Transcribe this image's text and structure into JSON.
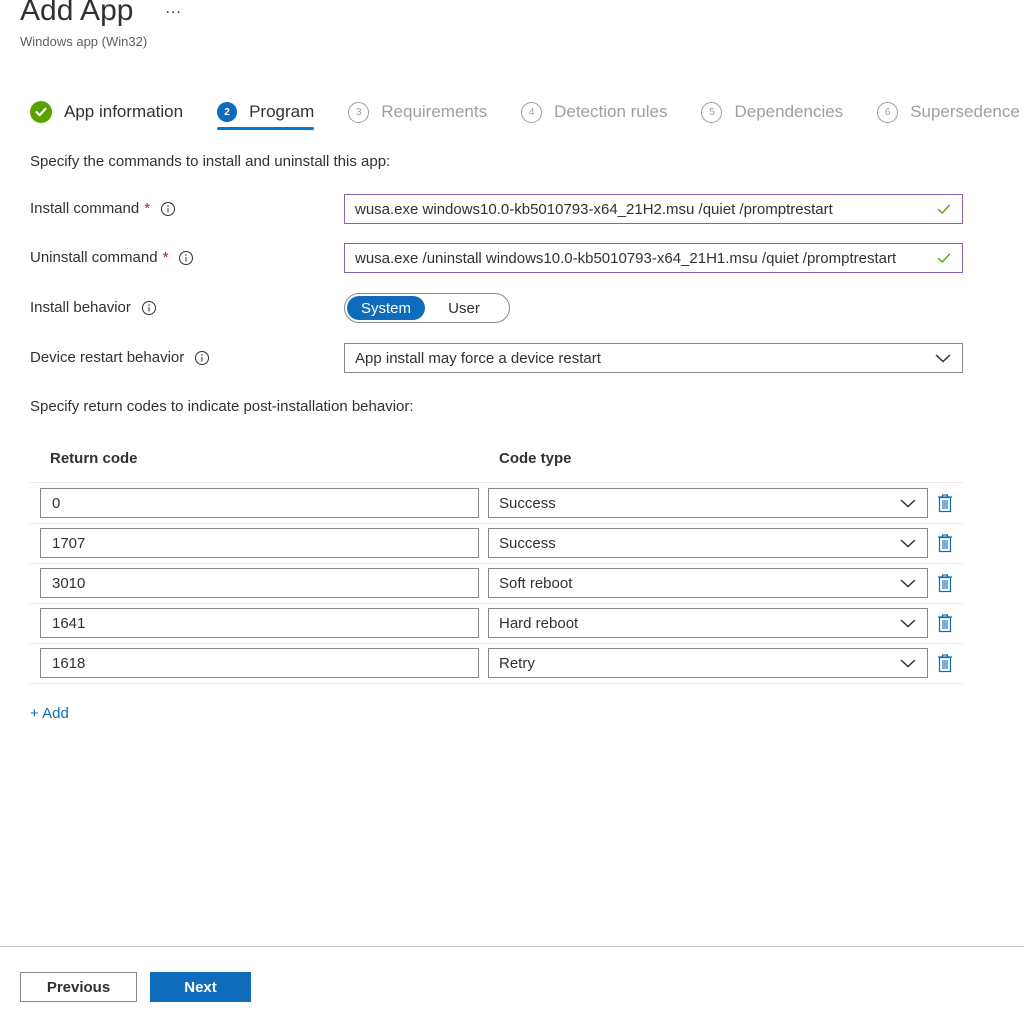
{
  "header": {
    "title": "Add App",
    "more": "...",
    "subtitle": "Windows app (Win32)"
  },
  "steps": [
    {
      "number": "",
      "label": "App information",
      "state": "done"
    },
    {
      "number": "2",
      "label": "Program",
      "state": "current"
    },
    {
      "number": "3",
      "label": "Requirements",
      "state": "pending"
    },
    {
      "number": "4",
      "label": "Detection rules",
      "state": "pending"
    },
    {
      "number": "5",
      "label": "Dependencies",
      "state": "pending"
    },
    {
      "number": "6",
      "label": "Supersedence",
      "state": "pending"
    }
  ],
  "program": {
    "intro": "Specify the commands to install and uninstall this app:",
    "install_command": {
      "label": "Install command",
      "required_mark": "*",
      "value": "wusa.exe windows10.0-kb5010793-x64_21H2.msu /quiet /promptrestart"
    },
    "uninstall_command": {
      "label": "Uninstall command",
      "required_mark": "*",
      "value": "wusa.exe /uninstall windows10.0-kb5010793-x64_21H1.msu /quiet /promptrestart"
    },
    "install_behavior": {
      "label": "Install behavior",
      "options": [
        "System",
        "User"
      ],
      "selected": "System"
    },
    "device_restart": {
      "label": "Device restart behavior",
      "value": "App install may force a device restart"
    }
  },
  "return_codes": {
    "intro": "Specify return codes to indicate post-installation behavior:",
    "col_code": "Return code",
    "col_type": "Code type",
    "rows": [
      {
        "code": "0",
        "type": "Success"
      },
      {
        "code": "1707",
        "type": "Success"
      },
      {
        "code": "3010",
        "type": "Soft reboot"
      },
      {
        "code": "1641",
        "type": "Hard reboot"
      },
      {
        "code": "1618",
        "type": "Retry"
      }
    ],
    "add_label": "+ Add"
  },
  "footer": {
    "previous_label": "Previous",
    "next_label": "Next"
  },
  "colors": {
    "accent": "#0f6cbd",
    "success": "#57a300",
    "required": "#a4262c",
    "valid_border": "#8764b8"
  }
}
